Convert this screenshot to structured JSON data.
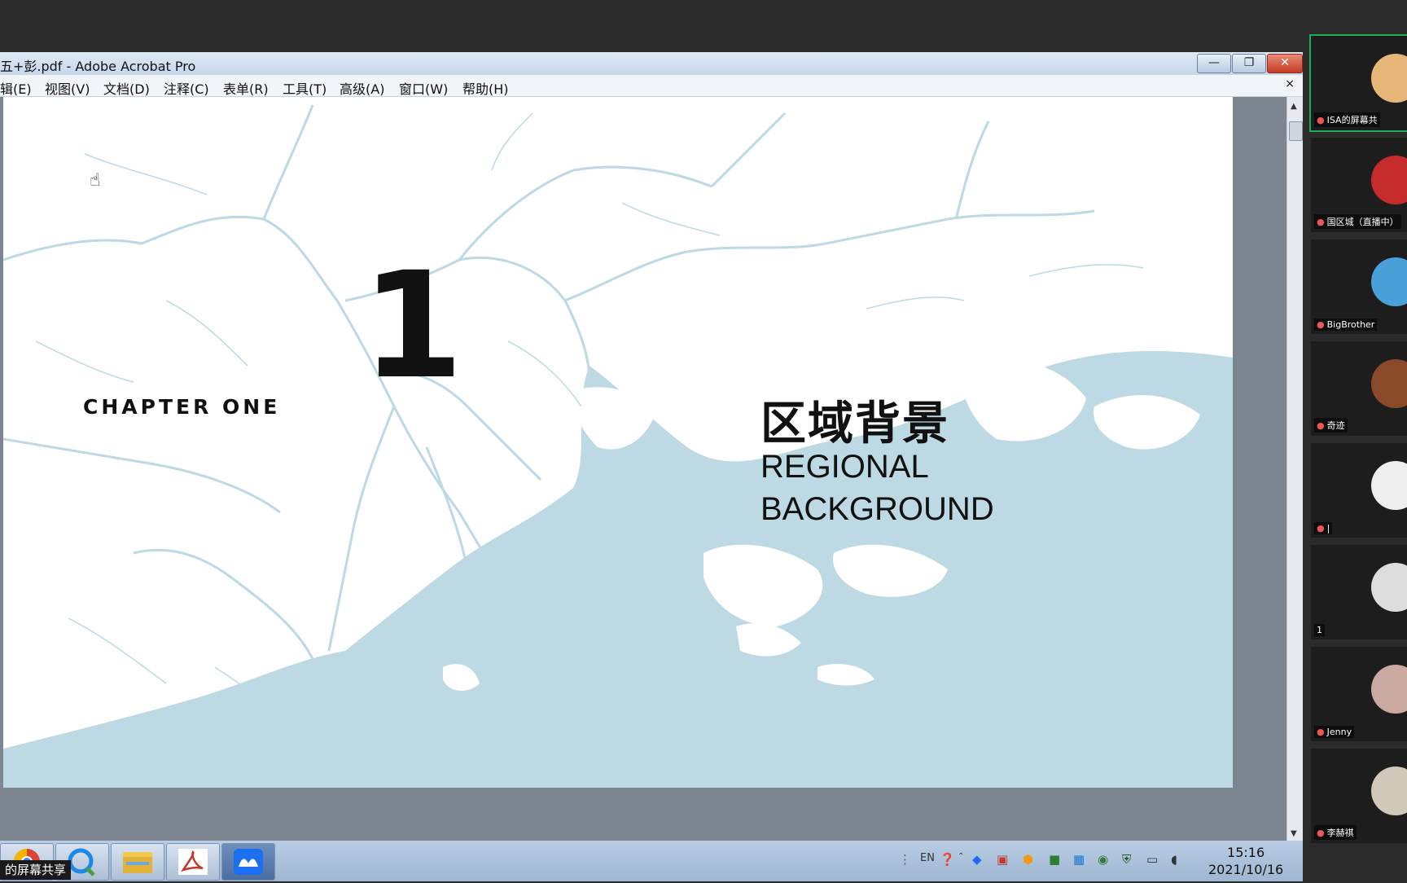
{
  "window": {
    "title": "五+彭.pdf - Adobe Acrobat Pro",
    "minimize": "—",
    "restore": "❐",
    "close": "✕"
  },
  "menu": {
    "items": [
      "辑(E)",
      "视图(V)",
      "文档(D)",
      "注释(C)",
      "表单(R)",
      "工具(T)",
      "高级(A)",
      "窗口(W)",
      "帮助(H)"
    ],
    "close_mark": "×"
  },
  "slide": {
    "chapter": "CHAPTER ONE",
    "number": "1",
    "title_cn": "区域背景",
    "title_en_line1": "REGIONAL",
    "title_en_line2": "BACKGROUND"
  },
  "taskbar": {
    "apps": [
      "chrome-icon",
      "qq-browser-icon",
      "file-explorer-icon",
      "acrobat-icon",
      "tencent-meeting-icon"
    ],
    "tray_lang": "EN",
    "time": "15:16",
    "date": "2021/10/16"
  },
  "share_label": "的屏幕共享",
  "participants": [
    {
      "name": "ISA的屏幕共",
      "active": true,
      "avatar_color": "#e7b77a"
    },
    {
      "name": "国区城（直播中）",
      "active": false,
      "avatar_color": "#c62b2b"
    },
    {
      "name": "BigBrother",
      "active": false,
      "avatar_color": "#4aa0d8"
    },
    {
      "name": "奇迹",
      "active": false,
      "avatar_color": "#8a4a2a"
    },
    {
      "name": "|",
      "active": false,
      "avatar_color": "#eeeeee"
    },
    {
      "name": "1",
      "active": false,
      "avatar_color": "#dddddd"
    },
    {
      "name": "Jenny",
      "active": false,
      "avatar_color": "#c9a9a0"
    },
    {
      "name": "李赫祺",
      "active": false,
      "avatar_color": "#d0c8b8"
    }
  ]
}
